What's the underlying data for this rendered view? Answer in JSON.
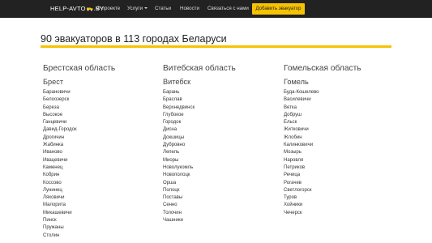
{
  "nav": {
    "brand_pre": "HELP-AVTO",
    "brand_post": ".BY",
    "items": [
      {
        "label": "О проекте"
      },
      {
        "label": "Услуги"
      },
      {
        "label": "Статьи"
      },
      {
        "label": "Новости"
      },
      {
        "label": "Связаться с нами"
      }
    ],
    "add_button": "Добавить эвакуатор",
    "colors": {
      "bar": "#222222",
      "accent": "#f7c200"
    }
  },
  "page": {
    "title": "90 эвакуаторов в 113 городах Беларуси"
  },
  "columns": [
    {
      "region": "Брестская область",
      "city": "Брест",
      "towns": [
        "Барановичи",
        "Белоозерск",
        "Береза",
        "Высокое",
        "Ганцевичи",
        "Давид-Городок",
        "Дрогичин",
        "Жабинка",
        "Иваново",
        "Ивацевичи",
        "Каменец",
        "Кобрин",
        "Коссово",
        "Лунинец",
        "Ляховичи",
        "Малорита",
        "Микашевичи",
        "Пинск",
        "Пружаны",
        "Столин"
      ]
    },
    {
      "region": "Витебская область",
      "city": "Витебск",
      "towns": [
        "Барань",
        "Браслав",
        "Верхнедвинск",
        "Глубокое",
        "Городок",
        "Дисна",
        "Докшицы",
        "Дубровно",
        "Лепель",
        "Миоры",
        "Новолукомль",
        "Новополоцк",
        "Орша",
        "Полоцк",
        "Поставы",
        "Сенно",
        "Толочин",
        "Чашники"
      ]
    },
    {
      "region": "Гомельская область",
      "city": "Гомель",
      "towns": [
        "Буда-Кошелево",
        "Василевичи",
        "Ветка",
        "Добруш",
        "Ельск",
        "Житковичи",
        "Жлобин",
        "Калинковичи",
        "Мозырь",
        "Наровля",
        "Петриков",
        "Речица",
        "Рогачев",
        "Светлогорск",
        "Туров",
        "Хойники",
        "Чечерск"
      ]
    }
  ]
}
